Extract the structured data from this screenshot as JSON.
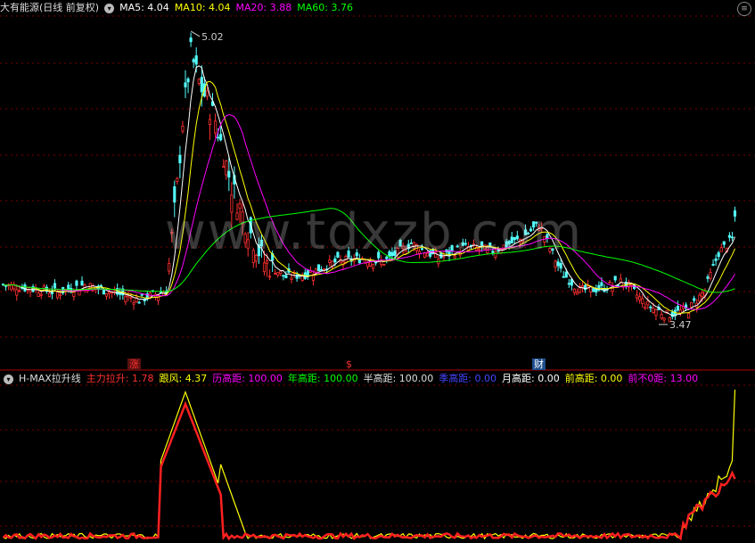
{
  "header": {
    "title": "大有能源(日线 前复权)",
    "ma_items": [
      {
        "label": "MA5: 4.04",
        "color": "#ffffff"
      },
      {
        "label": "MA10: 4.04",
        "color": "#ffff00"
      },
      {
        "label": "MA20: 3.88",
        "color": "#ff00ff"
      },
      {
        "label": "MA60: 3.76",
        "color": "#00ff00"
      }
    ]
  },
  "watermark": "www.tdxzb.com",
  "events": [
    {
      "label": "涨",
      "color": "#ff3030",
      "bg": "#5a1010"
    },
    {
      "label": "$",
      "color": "#ff3030",
      "bg": "transparent"
    },
    {
      "label": "财",
      "color": "#ffffff",
      "bg": "#1e4c8c"
    }
  ],
  "indicator_header": {
    "name": "H-MAX拉升线",
    "items": [
      {
        "label": "主力拉升: 1.78",
        "color": "#ff3030"
      },
      {
        "label": "跟风: 4.37",
        "color": "#ffff00"
      },
      {
        "label": "历高距: 100.00",
        "color": "#ff00ff"
      },
      {
        "label": "年高距: 100.00",
        "color": "#00ff00"
      },
      {
        "label": "半高距: 100.00",
        "color": "#dddddd"
      },
      {
        "label": "季高距: 0.00",
        "color": "#4040ff"
      },
      {
        "label": "月高距: 0.00",
        "color": "#ffffff"
      },
      {
        "label": "前高距: 0.00",
        "color": "#ffff00"
      },
      {
        "label": "前不0距: 13.00",
        "color": "#ff00ff"
      }
    ]
  },
  "chart_data": [
    {
      "type": "candlestick",
      "title": "大有能源(日线 前复权)",
      "ylim": [
        3.3,
        5.1
      ],
      "annotations": [
        {
          "text": "5.02",
          "value": 5.02,
          "at_index": 69
        },
        {
          "text": "3.47",
          "value": 3.47,
          "at_index": 241
        }
      ],
      "up_color": "#ff3030",
      "down_color": "#54ffff",
      "series": [
        {
          "name": "MA5",
          "color": "#ffffff",
          "last": 4.04
        },
        {
          "name": "MA10",
          "color": "#ffff00",
          "last": 4.04
        },
        {
          "name": "MA20",
          "color": "#ff00ff",
          "last": 3.88
        },
        {
          "name": "MA60",
          "color": "#00ff00",
          "last": 3.76
        }
      ]
    },
    {
      "type": "line",
      "title": "H-MAX拉升线",
      "ylim": [
        0,
        4.5
      ],
      "series": [
        {
          "name": "主力拉升",
          "color": "#ff2020",
          "last": 1.78
        },
        {
          "name": "跟风",
          "color": "#ffff00",
          "last": 4.37
        }
      ]
    }
  ]
}
